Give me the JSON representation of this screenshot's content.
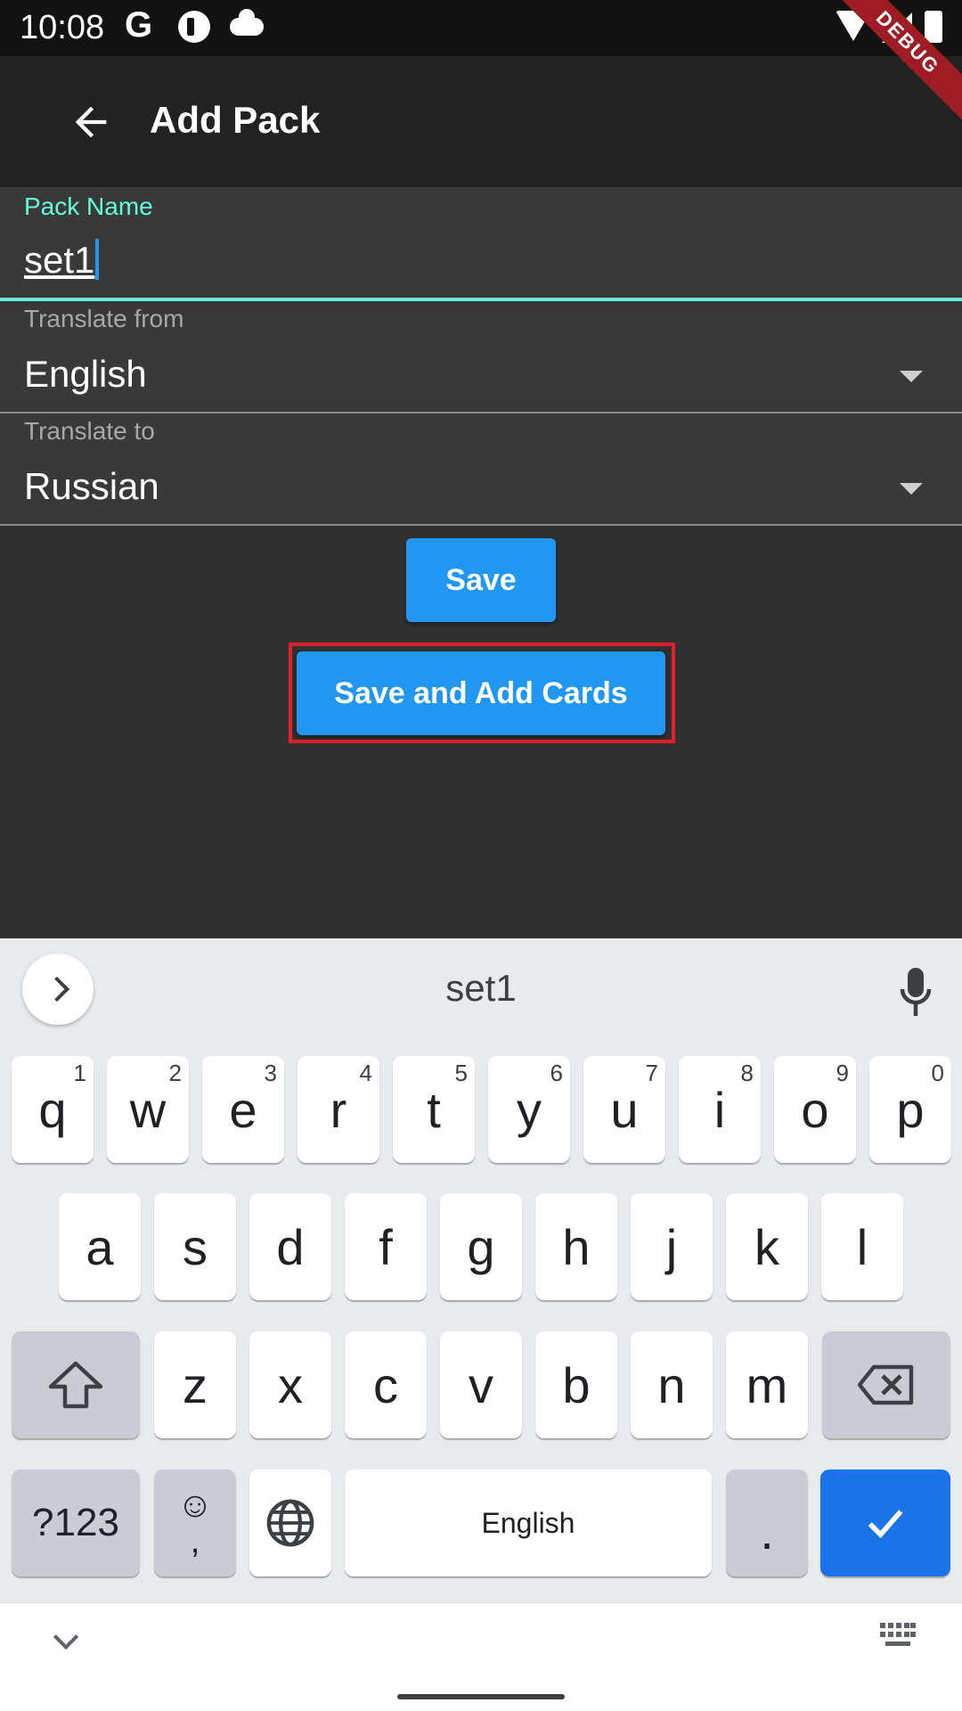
{
  "status_bar": {
    "time": "10:08",
    "g_glyph": "G",
    "debug_label": "DEBUG"
  },
  "app_bar": {
    "title": "Add Pack",
    "back_icon": "arrow-back-icon"
  },
  "form": {
    "pack_name": {
      "label": "Pack Name",
      "value": "set1"
    },
    "translate_from": {
      "label": "Translate from",
      "value": "English"
    },
    "translate_to": {
      "label": "Translate to",
      "value": "Russian"
    }
  },
  "buttons": {
    "save": "Save",
    "save_and_add_cards": "Save and Add Cards"
  },
  "keyboard": {
    "suggestion": "set1",
    "row1": [
      {
        "k": "q",
        "h": "1"
      },
      {
        "k": "w",
        "h": "2"
      },
      {
        "k": "e",
        "h": "3"
      },
      {
        "k": "r",
        "h": "4"
      },
      {
        "k": "t",
        "h": "5"
      },
      {
        "k": "y",
        "h": "6"
      },
      {
        "k": "u",
        "h": "7"
      },
      {
        "k": "i",
        "h": "8"
      },
      {
        "k": "o",
        "h": "9"
      },
      {
        "k": "p",
        "h": "0"
      }
    ],
    "row2": [
      "a",
      "s",
      "d",
      "f",
      "g",
      "h",
      "j",
      "k",
      "l"
    ],
    "row3": [
      "z",
      "x",
      "c",
      "v",
      "b",
      "n",
      "m"
    ],
    "symbols_label": "?123",
    "emoji_label": "☺",
    "comma_label": ",",
    "space_label": "English",
    "period_label": "."
  },
  "colors": {
    "accent": "#64ffda",
    "button": "#2196f3",
    "highlight": "#e0202a",
    "keyboard_action": "#1a73e8"
  }
}
